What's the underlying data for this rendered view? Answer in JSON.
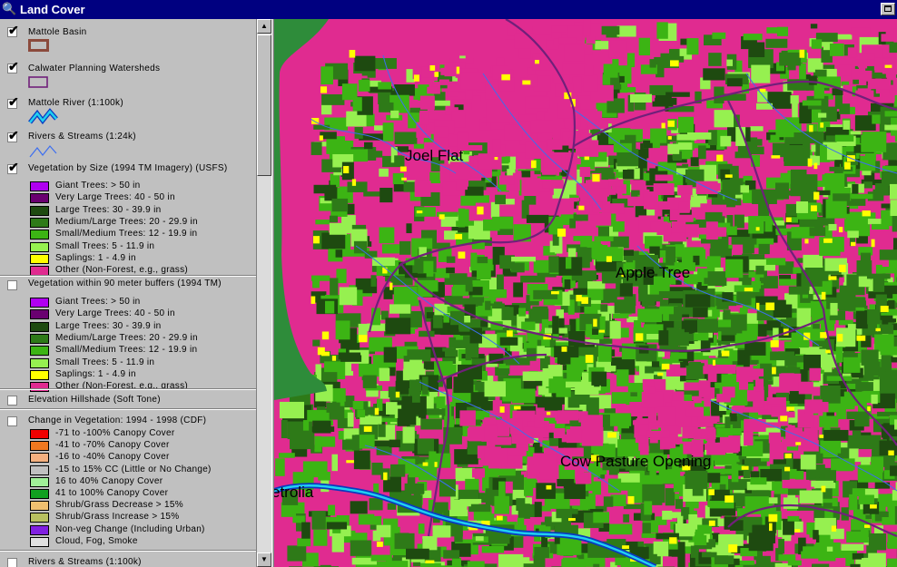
{
  "window": {
    "title": "Land Cover"
  },
  "colors": {
    "title_bar": "#000080",
    "nonforest": "#e02b90",
    "basin_outline": "#8b4a3c",
    "watershed_outline": "#70207a"
  },
  "legend": {
    "layers": [
      {
        "name": "Mattole Basin",
        "checked": true,
        "symbol": "basin-outline"
      },
      {
        "name": "Calwater Planning Watersheds",
        "checked": true,
        "symbol": "watershed-outline"
      },
      {
        "name": "Mattole River (1:100k)",
        "checked": true,
        "symbol": "river-line"
      },
      {
        "name": "Rivers & Streams (1:24k)",
        "checked": true,
        "symbol": "stream-line"
      },
      {
        "name": "Vegetation by Size (1994 TM Imagery) (USFS)",
        "checked": true,
        "classes": [
          {
            "label": "Giant Trees: > 50 in",
            "color": "#b000f0"
          },
          {
            "label": "Very Large Trees: 40 - 50 in",
            "color": "#6a0070"
          },
          {
            "label": "Large Trees: 30 - 39.9 in",
            "color": "#1e4a10"
          },
          {
            "label": "Medium/Large Trees: 20 - 29.9 in",
            "color": "#2e7a18"
          },
          {
            "label": "Small/Medium Trees: 12 - 19.9 in",
            "color": "#3cb414"
          },
          {
            "label": "Small Trees: 5 - 11.9 in",
            "color": "#96f050"
          },
          {
            "label": "Saplings: 1 - 4.9 in",
            "color": "#ffff00"
          },
          {
            "label": "Other (Non-Forest, e.g., grass)",
            "color": "#e02b90"
          }
        ]
      },
      {
        "name": "Vegetation within 90 meter buffers (1994 TM)",
        "checked": false,
        "classes": [
          {
            "label": "Giant Trees: > 50 in",
            "color": "#b000f0"
          },
          {
            "label": "Very Large Trees: 40 - 50 in",
            "color": "#6a0070"
          },
          {
            "label": "Large Trees: 30 - 39.9 in",
            "color": "#1e4a10"
          },
          {
            "label": "Medium/Large Trees: 20 - 29.9 in",
            "color": "#2e7a18"
          },
          {
            "label": "Small/Medium Trees: 12 - 19.9 in",
            "color": "#3cb414"
          },
          {
            "label": "Small Trees: 5 - 11.9 in",
            "color": "#96f050"
          },
          {
            "label": "Saplings: 1 - 4.9 in",
            "color": "#ffff00"
          },
          {
            "label": "Other (Non-Forest, e.g., grass)",
            "color": "#e02b90"
          }
        ]
      },
      {
        "name": "Elevation Hillshade (Soft Tone)",
        "checked": false
      },
      {
        "name": "Change in Vegetation: 1994 - 1998 (CDF)",
        "checked": false,
        "classes": [
          {
            "label": "-71 to -100% Canopy Cover",
            "color": "#f00000"
          },
          {
            "label": "-41 to -70% Canopy Cover",
            "color": "#f07820"
          },
          {
            "label": "-16 to -40% Canopy Cover",
            "color": "#f4b080"
          },
          {
            "label": "-15 to 15% CC (Little or No Change)",
            "color": "#c0c0c0"
          },
          {
            "label": "16 to 40% Canopy Cover",
            "color": "#a0f098"
          },
          {
            "label": "41 to 100% Canopy Cover",
            "color": "#10a020"
          },
          {
            "label": "Shrub/Grass Decrease > 15%",
            "color": "#f0c070"
          },
          {
            "label": "Shrub/Grass Increase > 15%",
            "color": "#b8c060"
          },
          {
            "label": "Non-veg Change (Including Urban)",
            "color": "#8020e0"
          },
          {
            "label": "Cloud, Fog, Smoke",
            "color": "#e0e0e0"
          }
        ]
      },
      {
        "name": "Rivers & Streams (1:100k)",
        "checked": false
      }
    ]
  },
  "map": {
    "place_labels": [
      "Joel Flat",
      "Apple Tree",
      "Cow Pasture Opening",
      "etrolia"
    ]
  }
}
